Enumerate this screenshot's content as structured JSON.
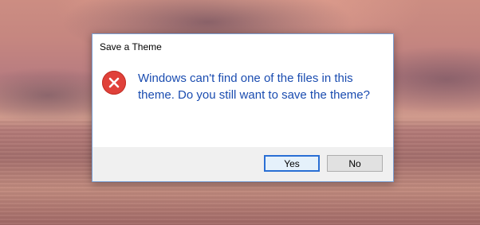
{
  "dialog": {
    "title": "Save a Theme",
    "icon": "error-icon",
    "message": "Windows can't find one of the files in this theme. Do you still want to save the theme?",
    "buttons": {
      "yes_label": "Yes",
      "no_label": "No"
    }
  },
  "colors": {
    "message_text": "#1a4cb0",
    "error_icon": "#e0413a",
    "default_button_border": "#2a6fd4",
    "button_bar": "#f0f0f0"
  }
}
